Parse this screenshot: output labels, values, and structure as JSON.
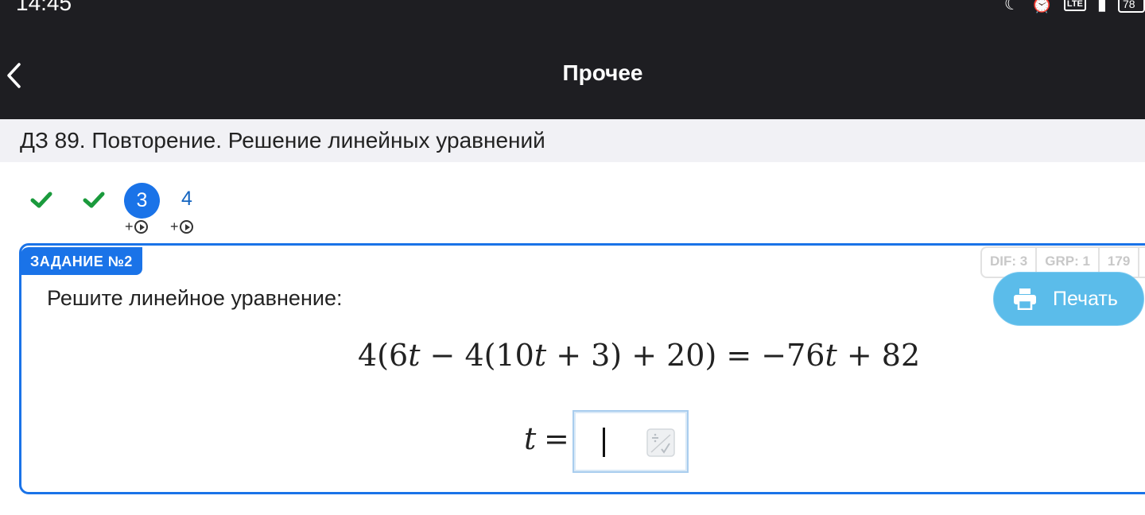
{
  "status_bar": {
    "time": "14:45",
    "lte": "LTE",
    "battery": "78"
  },
  "nav": {
    "title": "Прочее",
    "back_icon": "chevron-left-icon"
  },
  "assignment": {
    "title": "ДЗ 89. Повторение. Решение линейных уравнений"
  },
  "tabs": [
    {
      "label": "",
      "state": "done",
      "icon": "check-icon"
    },
    {
      "label": "",
      "state": "done",
      "icon": "check-icon"
    },
    {
      "label": "3",
      "state": "current",
      "badge": "+"
    },
    {
      "label": "4",
      "state": "todo",
      "badge": "+"
    }
  ],
  "task": {
    "badge": "ЗАДАНИЕ №2",
    "meta": [
      "DIF: 3",
      "GRP: 1",
      "179"
    ],
    "print_label": "Печать",
    "prompt": "Решите линейное уравнение:",
    "answer_var": "t",
    "answer_eq": "=",
    "answer_value": ""
  },
  "colors": {
    "nav_bg": "#1e1e22",
    "accent": "#1a73e8",
    "check": "#1a9a3c",
    "print_button": "#5bbcea"
  }
}
